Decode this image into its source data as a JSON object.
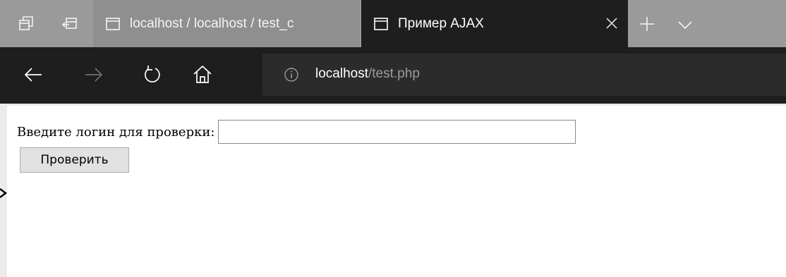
{
  "browser": {
    "tabs": [
      {
        "title": "localhost / localhost / test_c"
      },
      {
        "title": "Пример AJAX",
        "active": true
      }
    ],
    "url_host": "localhost",
    "url_path": "/test.php"
  },
  "page": {
    "login_label": "Введите логин для проверки:",
    "login_value": "",
    "check_button": "Проверить"
  },
  "icons": {
    "tab_actions": "tab-actions-icon",
    "set_tabs_aside": "set-tabs-aside-icon",
    "tab_page": "tab-page-icon",
    "close": "close-icon",
    "new_tab": "new-tab-icon",
    "tab_list": "chevron-down-icon",
    "back": "back-arrow-icon",
    "forward": "forward-arrow-icon",
    "refresh": "refresh-icon",
    "home": "home-icon",
    "site_info": "info-icon"
  },
  "colors": {
    "tabbar": "#9a9a9a",
    "active_tab": "#1e1e1e",
    "navbar": "#1e1e1e",
    "addressbar": "#2b2b2b",
    "url_path": "#9c9c9c"
  }
}
